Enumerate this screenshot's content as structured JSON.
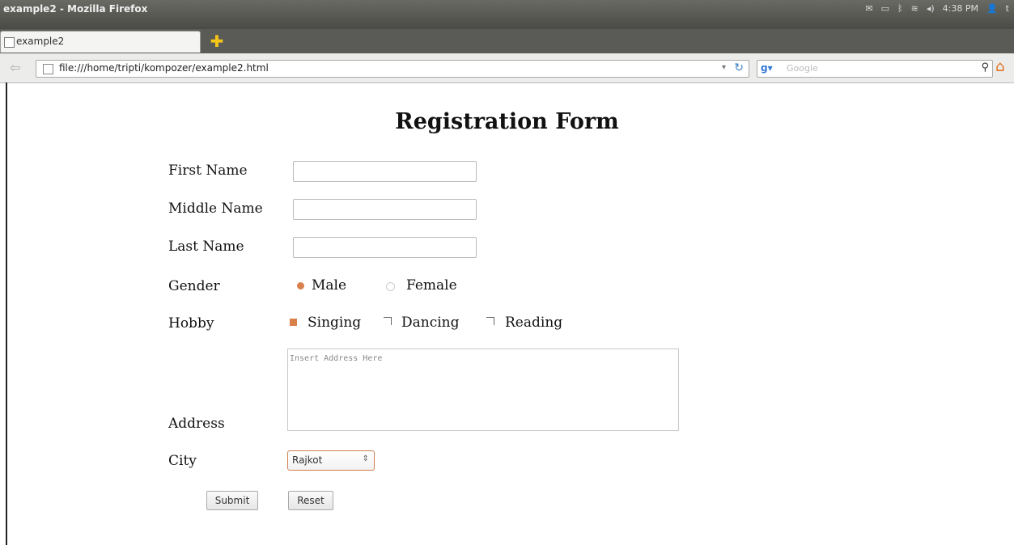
{
  "window": {
    "title": "example2 - Mozilla Firefox"
  },
  "tray": {
    "time": "4:38 PM",
    "user": "t"
  },
  "tab": {
    "label": "example2"
  },
  "nav": {
    "url": "file:///home/tripti/kompozer/example2.html",
    "search_placeholder": "Google"
  },
  "form": {
    "heading": "Registration Form",
    "first_name_label": "First Name",
    "middle_name_label": "Middle Name",
    "last_name_label": "Last Name",
    "gender_label": "Gender",
    "gender_options": [
      "Male",
      "Female"
    ],
    "gender_selected": "Male",
    "hobby_label": "Hobby",
    "hobby_options": [
      "Singing",
      "Dancing",
      "Reading"
    ],
    "hobby_checked": [
      "Singing"
    ],
    "address_label": "Address",
    "address_placeholder": "Insert Address Here",
    "city_label": "City",
    "city_value": "Rajkot",
    "submit_label": "Submit",
    "reset_label": "Reset"
  },
  "colors": {
    "accent": "#e08b3c",
    "titlebar": "#4f4f4b"
  }
}
